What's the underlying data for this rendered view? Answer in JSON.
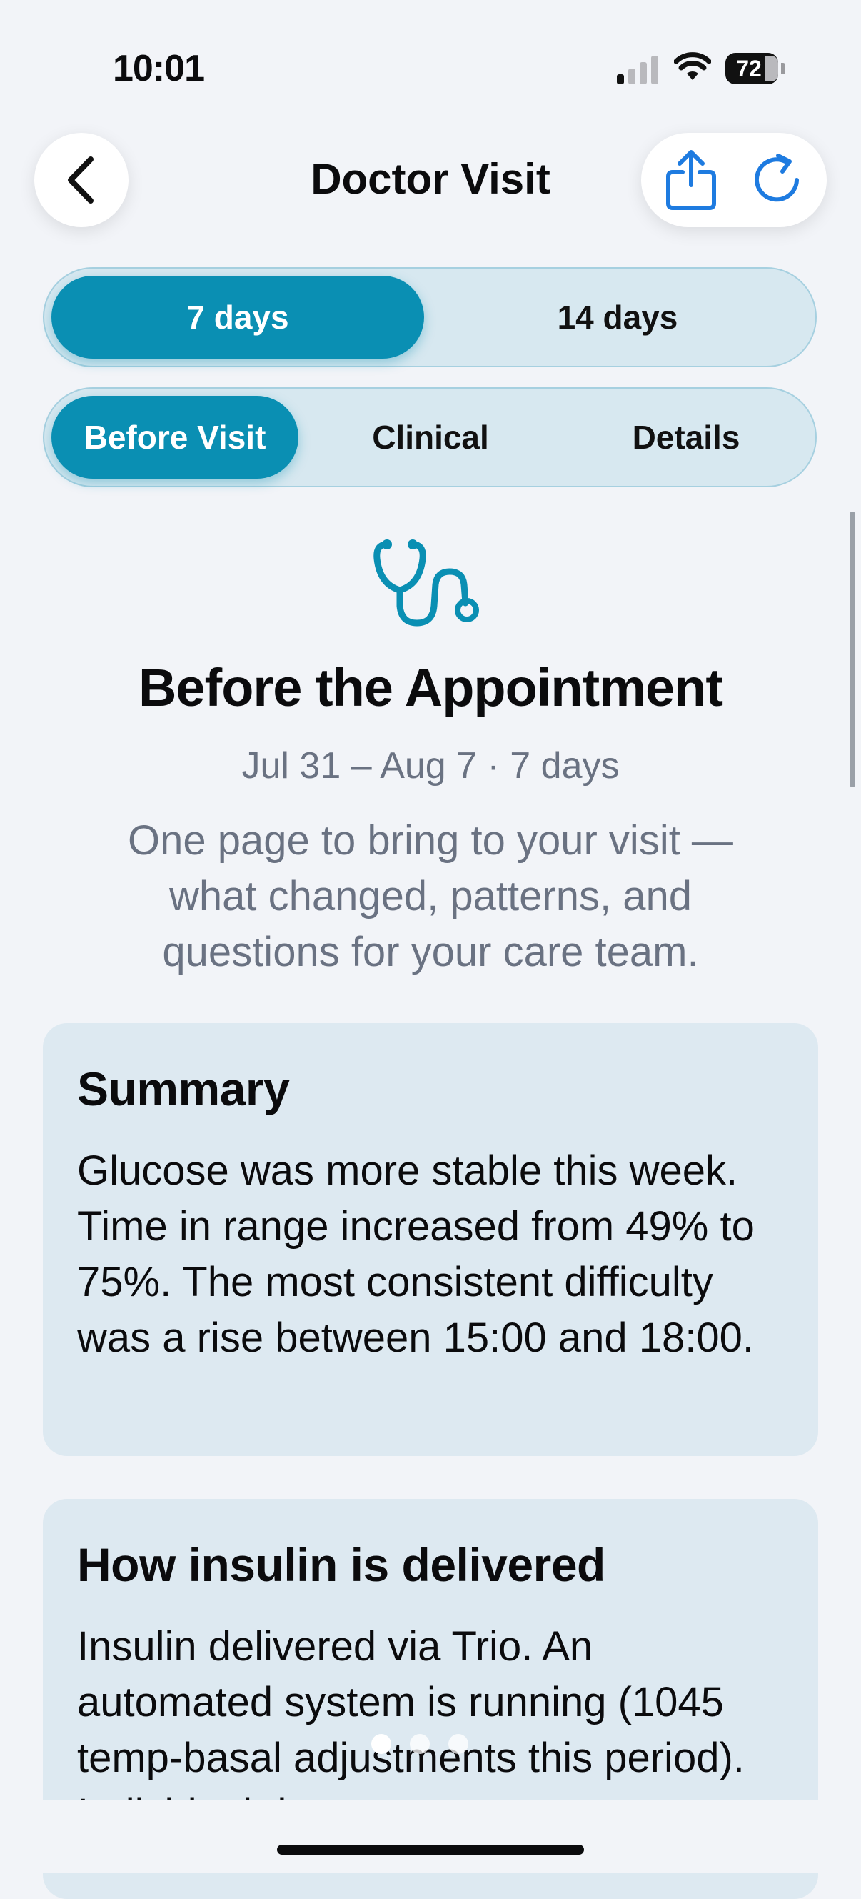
{
  "status_bar": {
    "time": "10:01",
    "battery": "72"
  },
  "nav": {
    "title": "Doctor Visit"
  },
  "range_tabs": [
    {
      "label": "7 days",
      "active": true
    },
    {
      "label": "14 days",
      "active": false
    }
  ],
  "view_tabs": [
    {
      "label": "Before Visit",
      "active": true
    },
    {
      "label": "Clinical",
      "active": false
    },
    {
      "label": "Details",
      "active": false
    }
  ],
  "hero": {
    "icon": "stethoscope-icon",
    "title": "Before the Appointment",
    "subtitle": "Jul 31 – Aug 7 · 7 days",
    "description": "One page to bring to your visit — what changed, patterns, and questions for your care team."
  },
  "cards": [
    {
      "title": "Summary",
      "body": "Glucose was more stable this week. Time in range increased from 49% to 75%. The most consistent difficulty was a rise between 15:00 and 18:00."
    },
    {
      "title": "How insulin is delivered",
      "body": "Insulin delivered via Trio. An automated system is running (1045 temp-basal adjustments this period). Individual do"
    }
  ],
  "colors": {
    "accent": "#0a8fb3",
    "action_blue": "#1e7be0",
    "card_bg": "#dde9f1",
    "muted_text": "#6a7282"
  }
}
